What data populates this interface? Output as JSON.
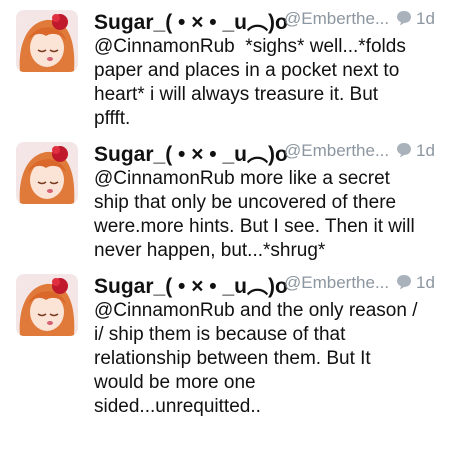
{
  "tweets": [
    {
      "name": "Sugar_( • × • _u︵)o",
      "handle": "@Emberthe...",
      "time": "1d",
      "text": "@CinnamonRub  *sighs* well...*folds\npaper and places in a pocket next to\nheart* i will always treasure it. But\npffft."
    },
    {
      "name": "Sugar_( • × • _u︵)o",
      "handle": "@Emberthe...",
      "time": "1d",
      "text": "@CinnamonRub more like a secret\nship that only be uncovered of there\nwere.more hints. But I see. Then it will\nnever happen, but...*shrug*"
    },
    {
      "name": "Sugar_( • × • _u︵)o",
      "handle": "@Emberthe...",
      "time": "1d",
      "text": "@CinnamonRub and the only reason /\ni/ ship them is because of that\nrelationship between them. But It\nwould be more one\nsided...unrequitted.."
    }
  ],
  "icons": {
    "reply": "speech-bubble-icon",
    "avatar": "anime-avatar"
  },
  "colors": {
    "meta_gray": "#8c96a0",
    "hair_orange": "#e07a3a",
    "rose_red": "#c0182c"
  }
}
